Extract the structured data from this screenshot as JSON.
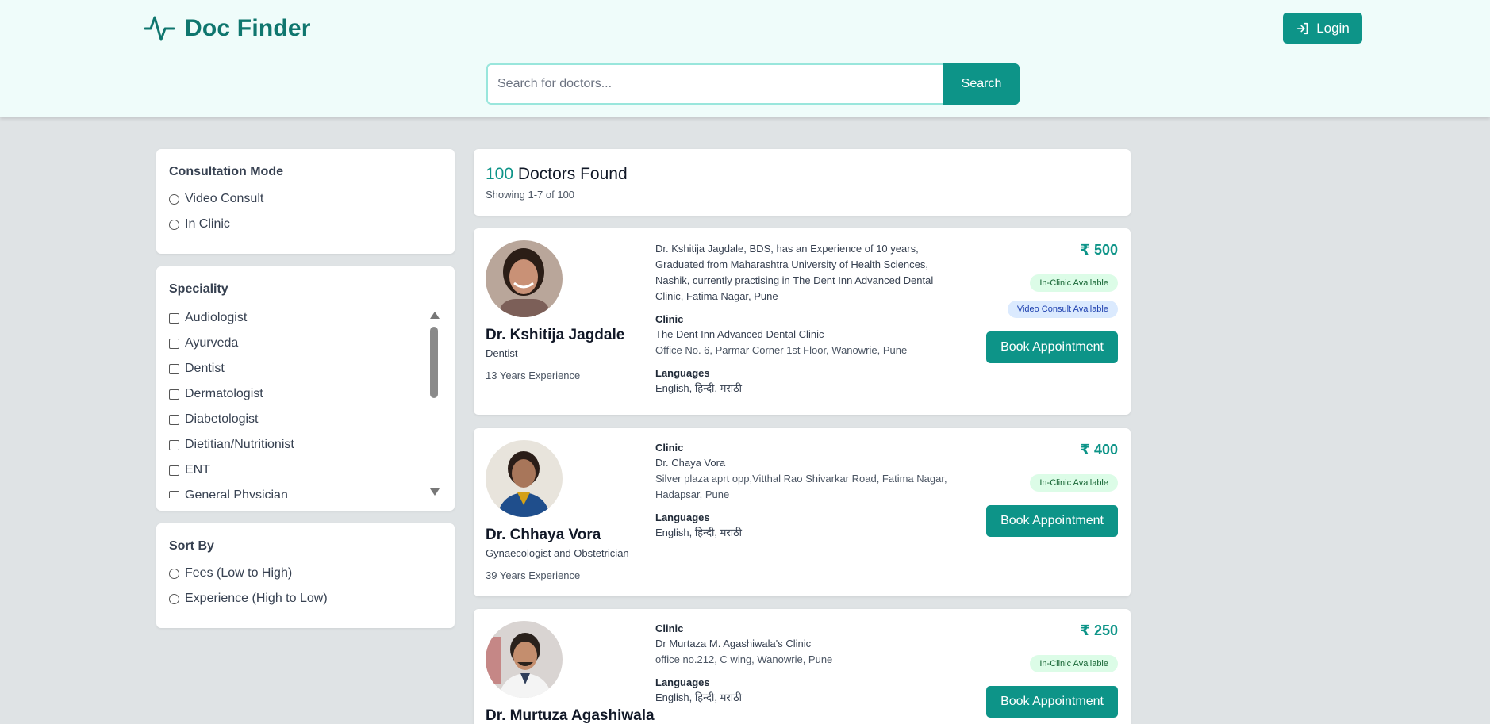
{
  "header": {
    "brand": "Doc Finder",
    "login_label": "Login",
    "search_placeholder": "Search for doctors...",
    "search_button": "Search"
  },
  "filters": {
    "consultation": {
      "title": "Consultation Mode",
      "options": [
        "Video Consult",
        "In Clinic"
      ]
    },
    "speciality": {
      "title": "Speciality",
      "options": [
        "Audiologist",
        "Ayurveda",
        "Dentist",
        "Dermatologist",
        "Diabetologist",
        "Dietitian/Nutritionist",
        "ENT",
        "General Physician"
      ]
    },
    "sort": {
      "title": "Sort By",
      "options": [
        "Fees (Low to High)",
        "Experience (High to Low)"
      ]
    }
  },
  "results": {
    "count": "100",
    "count_label": "Doctors Found",
    "showing": "Showing 1-7 of 100"
  },
  "labels": {
    "clinic": "Clinic",
    "languages": "Languages",
    "in_clinic": "In-Clinic Available",
    "video": "Video Consult Available",
    "book": "Book Appointment"
  },
  "doctors": [
    {
      "name": "Dr. Kshitija Jagdale",
      "speciality": "Dentist",
      "experience": "13 Years Experience",
      "description": "Dr. Kshitija Jagdale, BDS, has an Experience of 10 years, Graduated from Maharashtra University of Health Sciences, Nashik, currently practising in The Dent Inn Advanced Dental Clinic, Fatima Nagar, Pune",
      "clinic_name": "The Dent Inn Advanced Dental Clinic",
      "clinic_address": "Office No. 6, Parmar Corner 1st Floor, Wanowrie, Pune",
      "languages": "English, हिन्दी, मराठी",
      "fee": "₹ 500"
    },
    {
      "name": "Dr. Chhaya Vora",
      "speciality": "Gynaecologist and Obstetrician",
      "experience": "39 Years Experience",
      "clinic_name": "Dr. Chaya Vora",
      "clinic_address": "Silver plaza aprt opp,Vitthal Rao Shivarkar Road, Fatima Nagar, Hadapsar, Pune",
      "languages": "English, हिन्दी, मराठी",
      "fee": "₹ 400"
    },
    {
      "name": "Dr. Murtuza Agashiwala",
      "clinic_name": "Dr Murtaza M. Agashiwala's Clinic",
      "clinic_address": "office no.212, C wing, Wanowrie, Pune",
      "languages": "English, हिन्दी, मराठी",
      "fee": "₹ 250"
    }
  ],
  "colors": {
    "accent": "#0d9488",
    "brand": "#0f766e",
    "header_bg": "#effcfa",
    "page_bg": "#dfe3e5"
  },
  "icons": {
    "brand": "heartbeat-pulse-icon",
    "login": "login-arrow-icon"
  }
}
